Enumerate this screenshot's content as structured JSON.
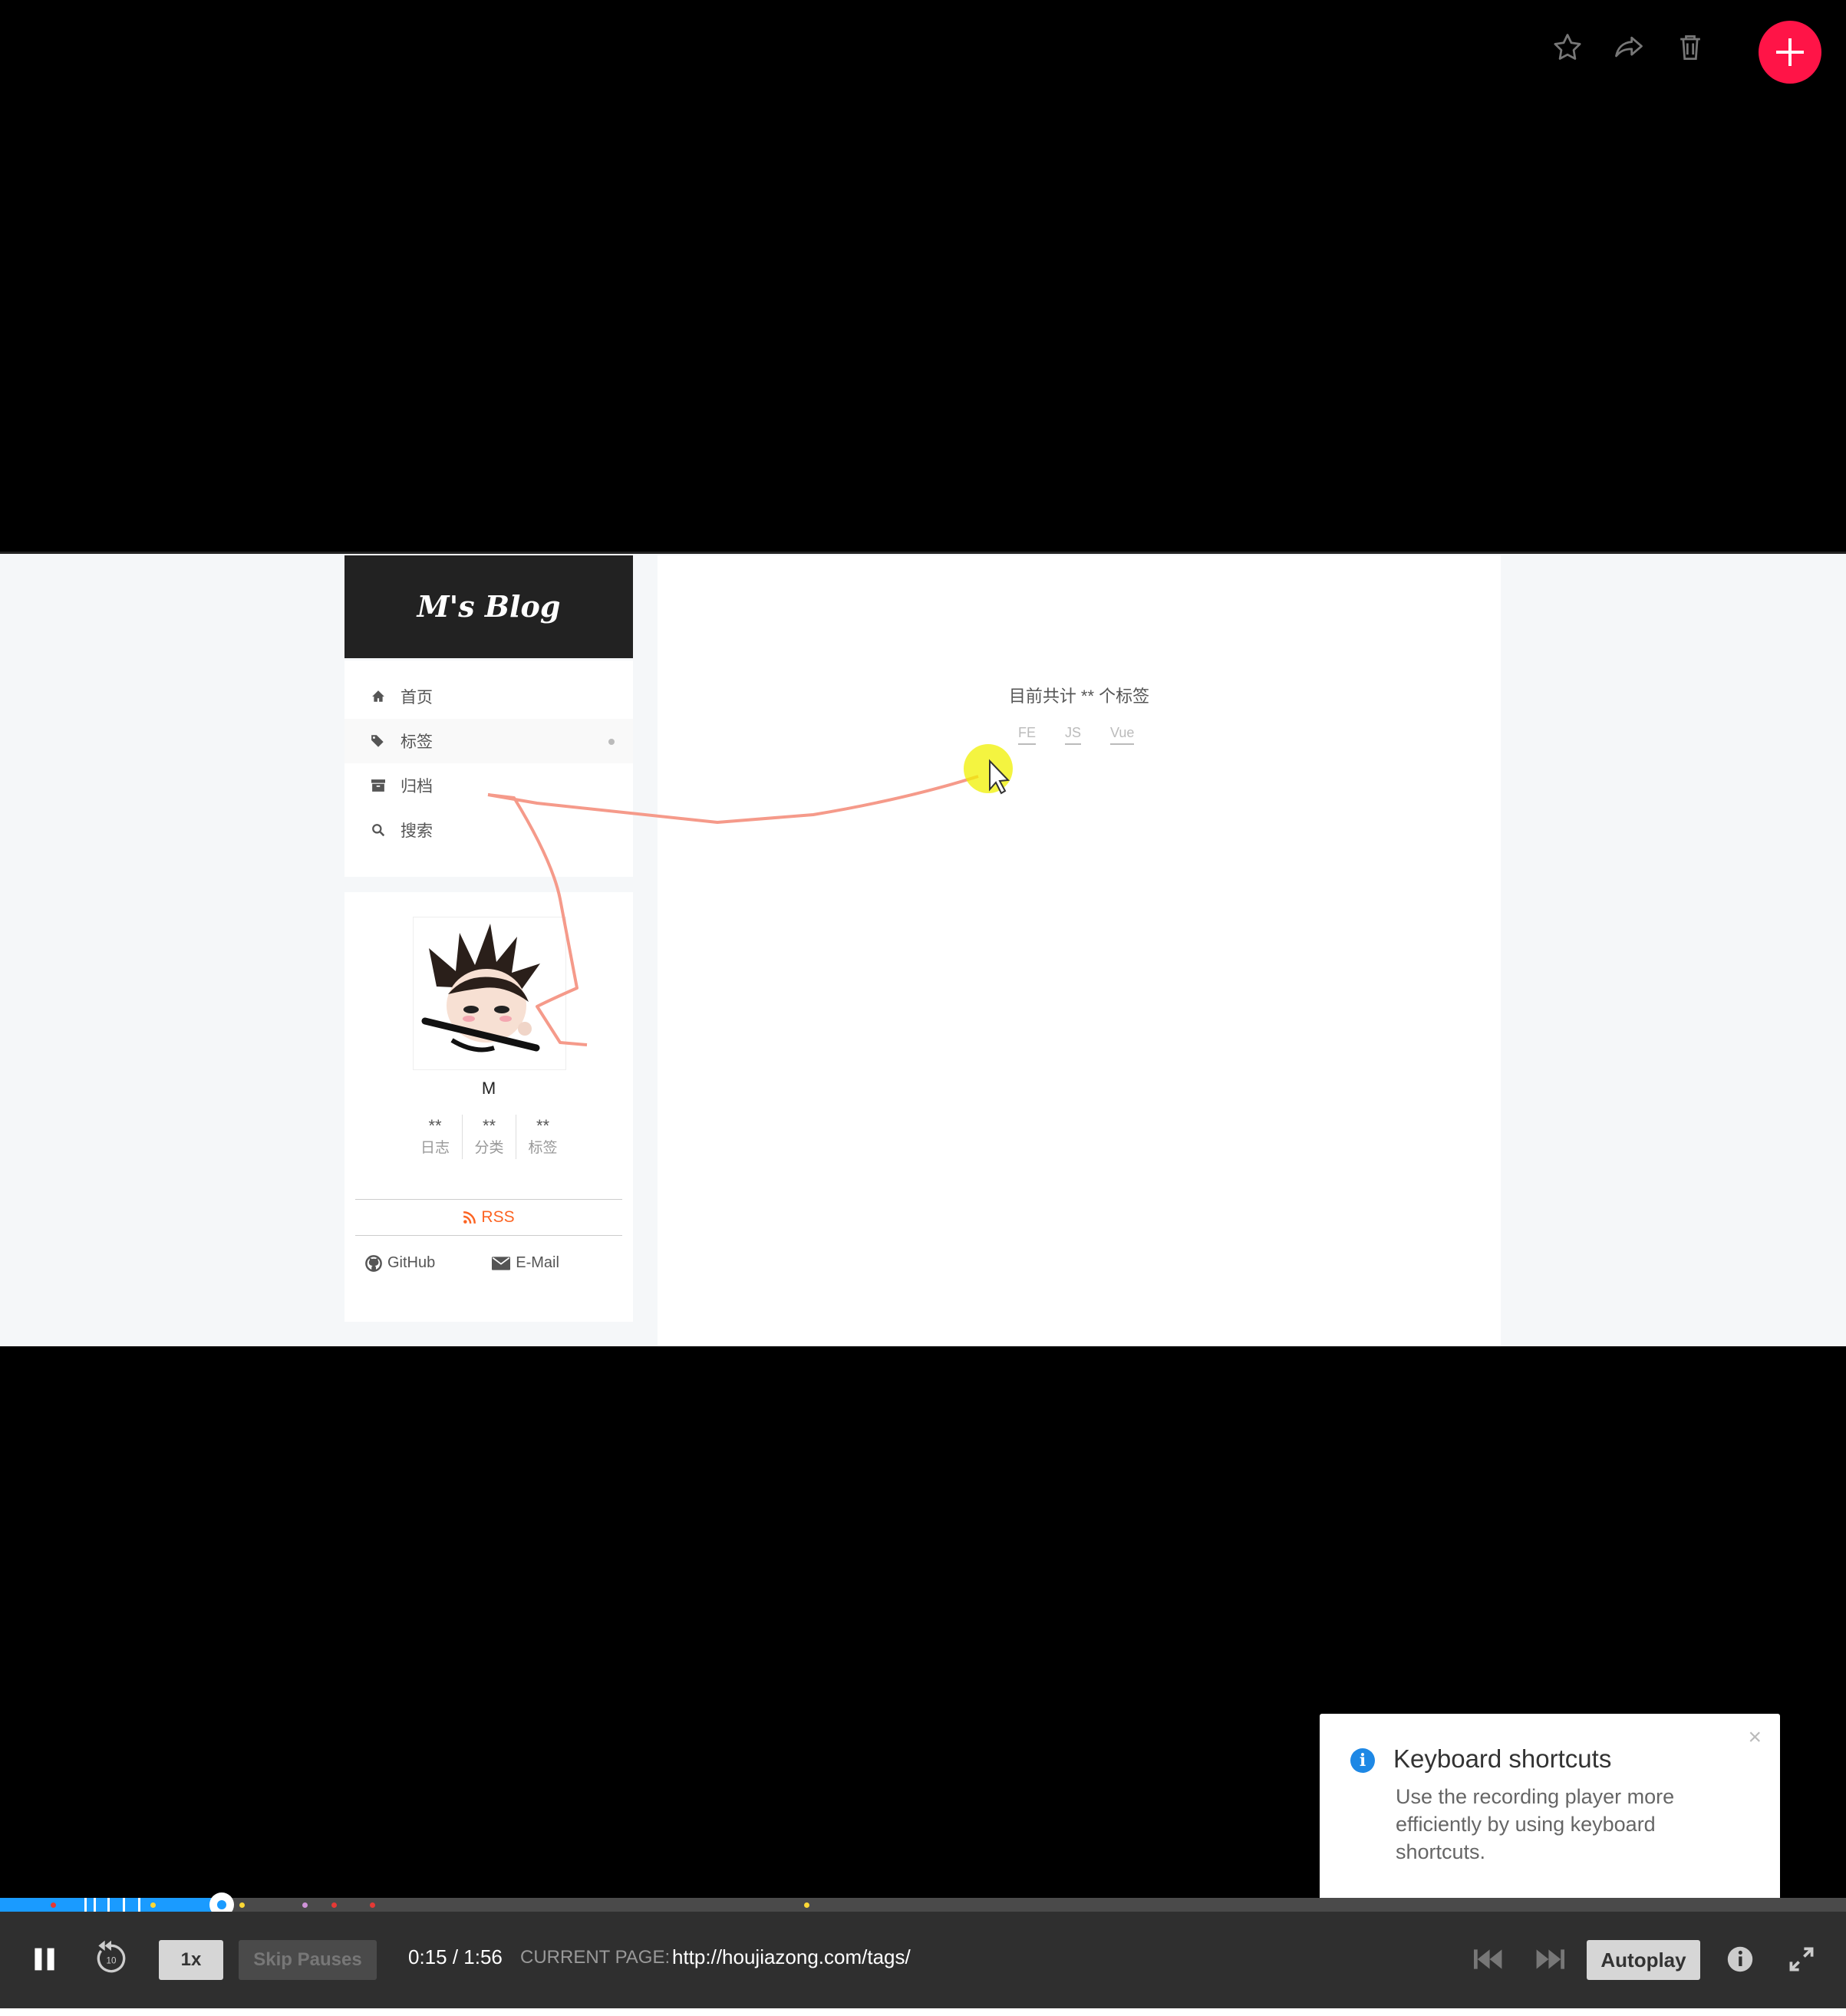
{
  "colors": {
    "accent": "#ff1447",
    "timeline_played": "#1a9bff",
    "rss": "#fc6423",
    "info": "#1e88e5"
  },
  "toolbar": {
    "icons": [
      "star-icon",
      "share-icon",
      "trash-icon",
      "plus-icon"
    ]
  },
  "blog": {
    "brand": "M's Blog",
    "menu": [
      {
        "label": "首页",
        "icon": "home-icon"
      },
      {
        "label": "标签",
        "icon": "tags-icon",
        "active": true
      },
      {
        "label": "归档",
        "icon": "archive-icon"
      },
      {
        "label": "搜索",
        "icon": "search-icon"
      }
    ],
    "author": "M",
    "stats": [
      {
        "value": "**",
        "label": "日志"
      },
      {
        "value": "**",
        "label": "分类"
      },
      {
        "value": "**",
        "label": "标签"
      }
    ],
    "rss": "RSS",
    "links": [
      {
        "label": "GitHub",
        "icon": "github-icon"
      },
      {
        "label": "E-Mail",
        "icon": "envelope-icon"
      }
    ],
    "tag_title": "目前共计 ** 个标签",
    "tags": [
      "FE",
      "JS",
      "Vue"
    ]
  },
  "notice": {
    "title": "Keyboard shortcuts",
    "body": "Use the recording player more efficiently by using keyboard shortcuts.",
    "close": "×"
  },
  "player": {
    "progress": 0.12,
    "rewind_label": "10",
    "speed": "1x",
    "skip_pauses": "Skip Pauses",
    "time": "0:15 / 1:56",
    "current_page_label": "CURRENT PAGE:",
    "current_page_url": "http://houjiazong.com/tags/",
    "autoplay": "Autoplay"
  }
}
